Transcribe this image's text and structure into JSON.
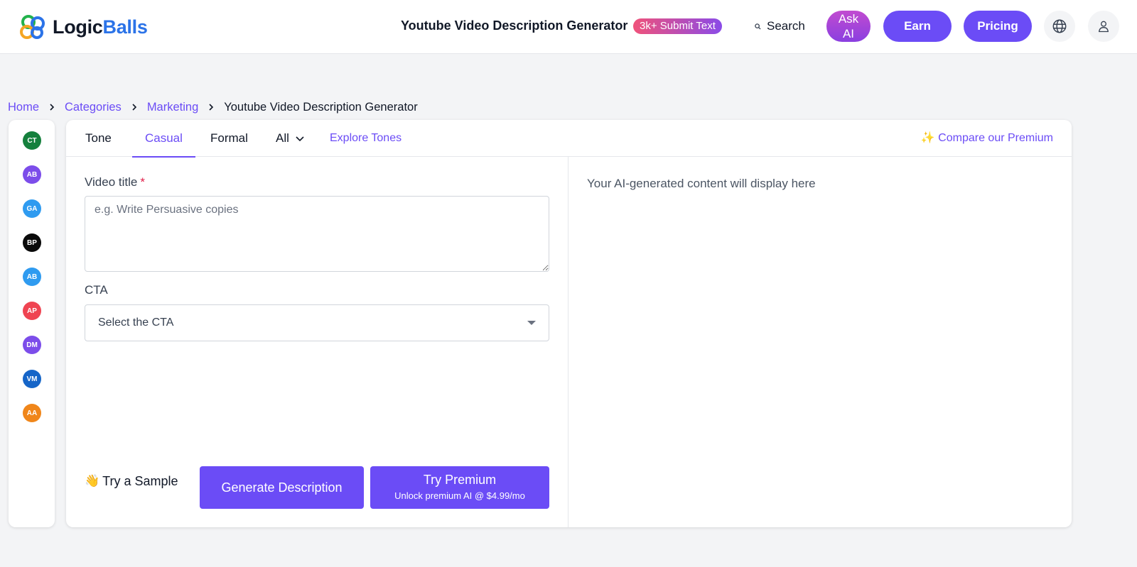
{
  "header": {
    "logo_part1": "Logic",
    "logo_part2": "Balls",
    "tool_title": "Youtube Video Description Generator",
    "submit_badge": "3k+ Submit Text",
    "search_label": "Search",
    "ask_ai_line1": "Ask",
    "ask_ai_line2": "AI",
    "earn_label": "Earn",
    "pricing_label": "Pricing"
  },
  "breadcrumb": {
    "items": [
      "Home",
      "Categories",
      "Marketing"
    ],
    "current": "Youtube Video Description Generator"
  },
  "rail": {
    "avatars": [
      {
        "initials": "CT",
        "color": "#15803d"
      },
      {
        "initials": "AB",
        "color": "#7c4dea"
      },
      {
        "initials": "GA",
        "color": "#2f9bf0"
      },
      {
        "initials": "BP",
        "color": "#0a0a0a"
      },
      {
        "initials": "AB",
        "color": "#2f9bf0"
      },
      {
        "initials": "AP",
        "color": "#ef4452"
      },
      {
        "initials": "DM",
        "color": "#7c4dea"
      },
      {
        "initials": "VM",
        "color": "#1565c8"
      },
      {
        "initials": "AA",
        "color": "#f0861a"
      }
    ]
  },
  "tabs": {
    "tone_label": "Tone",
    "casual": "Casual",
    "formal": "Formal",
    "all": "All",
    "explore": "Explore Tones",
    "compare": "✨ Compare our Premium"
  },
  "form": {
    "video_title_label": "Video title",
    "required_mark": "*",
    "video_title_placeholder": "e.g. Write Persuasive copies",
    "cta_label": "CTA",
    "cta_selected": "Select the CTA"
  },
  "actions": {
    "try_sample_emoji": "👋",
    "try_sample": "Try a Sample",
    "generate": "Generate Description",
    "premium_title": "Try Premium",
    "premium_sub": "Unlock premium AI @ $4.99/mo"
  },
  "output": {
    "placeholder": "Your AI-generated content will display here"
  },
  "colors": {
    "accent": "#6b4cf6",
    "logo_blue": "#2b73e8"
  }
}
